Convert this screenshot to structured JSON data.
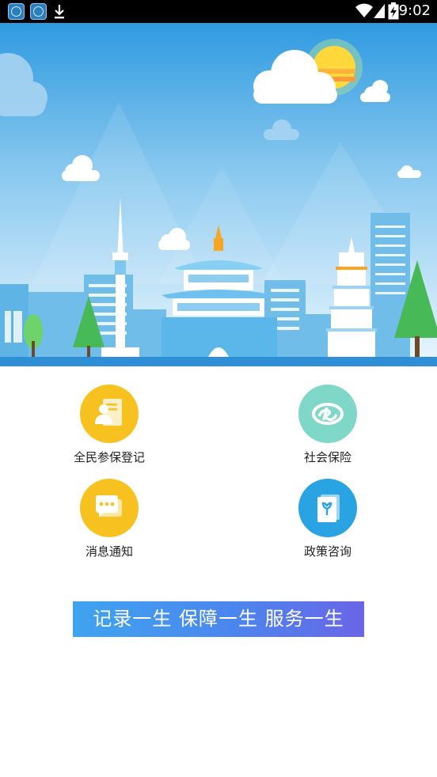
{
  "status_bar": {
    "time": "9:02",
    "notification_icons": [
      "app-icon",
      "app-icon",
      "download-icon"
    ],
    "system_icons": [
      "wifi-icon",
      "signal-icon",
      "battery-charging-icon"
    ]
  },
  "banner": {
    "theme_colors": {
      "sky_top": "#2f9ae0",
      "sky_bottom": "#eaf6fd",
      "ground": "#2e8fd6"
    },
    "illustration": "city-skyline-illustration"
  },
  "menu": {
    "items": [
      {
        "label": "全民参保登记",
        "icon": "registration-card-icon",
        "color": "#f7c21f"
      },
      {
        "label": "社会保险",
        "icon": "social-insurance-si-icon",
        "color": "#7fd7c7"
      },
      {
        "label": "消息通知",
        "icon": "chat-bubble-icon",
        "color": "#f7c21f"
      },
      {
        "label": "政策咨询",
        "icon": "policy-book-icon",
        "color": "#2aa3e2"
      }
    ]
  },
  "slogan": {
    "text": "记录一生  保障一生  服务一生"
  }
}
